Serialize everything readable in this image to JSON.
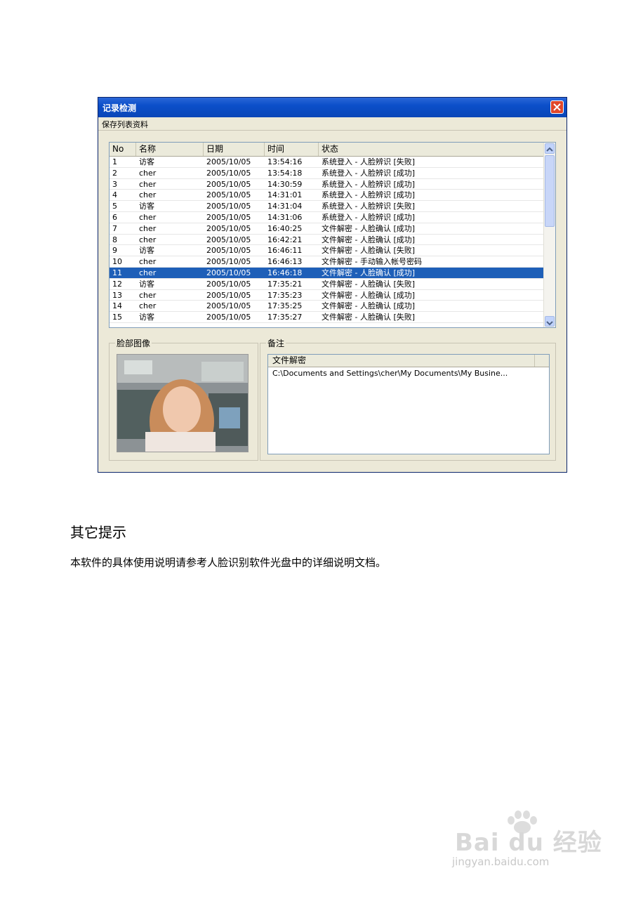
{
  "window": {
    "title": "记录检测",
    "menu": [
      "保存列表资料"
    ]
  },
  "list": {
    "columns": [
      "No",
      "名称",
      "日期",
      "时间",
      "状态"
    ],
    "rows": [
      {
        "no": "1",
        "name": "访客",
        "date": "2005/10/05",
        "time": "13:54:16",
        "status": "系统登入 - 人脸辨识 [失败]"
      },
      {
        "no": "2",
        "name": "cher",
        "date": "2005/10/05",
        "time": "13:54:18",
        "status": "系统登入 - 人脸辨识 [成功]"
      },
      {
        "no": "3",
        "name": "cher",
        "date": "2005/10/05",
        "time": "14:30:59",
        "status": "系统登入 - 人脸辨识 [成功]"
      },
      {
        "no": "4",
        "name": "cher",
        "date": "2005/10/05",
        "time": "14:31:01",
        "status": "系统登入 - 人脸辨识 [成功]"
      },
      {
        "no": "5",
        "name": "访客",
        "date": "2005/10/05",
        "time": "14:31:04",
        "status": "系统登入 - 人脸辨识 [失败]"
      },
      {
        "no": "6",
        "name": "cher",
        "date": "2005/10/05",
        "time": "14:31:06",
        "status": "系统登入 - 人脸辨识 [成功]"
      },
      {
        "no": "7",
        "name": "cher",
        "date": "2005/10/05",
        "time": "16:40:25",
        "status": "文件解密 - 人脸确认 [成功]"
      },
      {
        "no": "8",
        "name": "cher",
        "date": "2005/10/05",
        "time": "16:42:21",
        "status": "文件解密 - 人脸确认 [成功]"
      },
      {
        "no": "9",
        "name": "访客",
        "date": "2005/10/05",
        "time": "16:46:11",
        "status": "文件解密 - 人脸确认 [失败]"
      },
      {
        "no": "10",
        "name": "cher",
        "date": "2005/10/05",
        "time": "16:46:13",
        "status": "文件解密 - 手动输入帐号密码"
      },
      {
        "no": "11",
        "name": "cher",
        "date": "2005/10/05",
        "time": "16:46:18",
        "status": "文件解密 - 人脸确认 [成功]"
      },
      {
        "no": "12",
        "name": "访客",
        "date": "2005/10/05",
        "time": "17:35:21",
        "status": "文件解密 - 人脸确认 [失败]"
      },
      {
        "no": "13",
        "name": "cher",
        "date": "2005/10/05",
        "time": "17:35:23",
        "status": "文件解密 - 人脸确认 [成功]"
      },
      {
        "no": "14",
        "name": "cher",
        "date": "2005/10/05",
        "time": "17:35:25",
        "status": "文件解密 - 人脸确认 [成功]"
      },
      {
        "no": "15",
        "name": "访客",
        "date": "2005/10/05",
        "time": "17:35:27",
        "status": "文件解密 - 人脸确认 [失败]"
      }
    ],
    "selected_no": "11"
  },
  "face_image": {
    "label": "脸部图像"
  },
  "notes": {
    "label": "备注",
    "column": "文件解密",
    "value": "C:\\Documents and Settings\\cher\\My Documents\\My Busine..."
  },
  "doc": {
    "heading": "其它提示",
    "paragraph": "本软件的具体使用说明请参考人脸识别软件光盘中的详细说明文档。"
  },
  "watermark": {
    "brand": "Bai du 经验",
    "url": "jingyan.baidu.com"
  },
  "colors": {
    "titlebar": "#0b4fc9",
    "selection": "#1e5fb8",
    "window_bg": "#ece9d8"
  }
}
